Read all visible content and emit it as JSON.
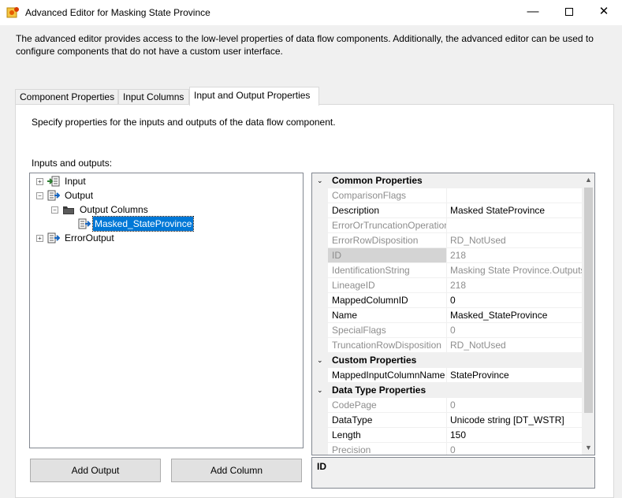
{
  "window": {
    "title": "Advanced Editor for Masking State Province",
    "minimize_glyph": "—",
    "close_glyph": "✕"
  },
  "description": "The advanced editor provides access to the low-level properties of data flow components. Additionally, the advanced editor can be used to configure components that do not have a custom user interface.",
  "tabs": [
    {
      "label": "Component Properties",
      "active": false
    },
    {
      "label": "Input Columns",
      "active": false
    },
    {
      "label": "Input and Output Properties",
      "active": true
    }
  ],
  "panel": {
    "description": "Specify properties for the inputs and outputs of the data flow component.",
    "inputs_outputs_label": "Inputs and outputs:"
  },
  "tree": {
    "nodes": [
      {
        "label": "Input",
        "expander": "+",
        "icon": "input-icon"
      },
      {
        "label": "Output",
        "expander": "−",
        "icon": "output-icon"
      },
      {
        "label": "Output Columns",
        "expander": "−",
        "icon": "folder-icon"
      },
      {
        "label": "Masked_StateProvince",
        "expander": "",
        "icon": "column-icon",
        "selected": true
      },
      {
        "label": "ErrorOutput",
        "expander": "+",
        "icon": "output-icon"
      }
    ]
  },
  "buttons": {
    "add_output": "Add Output",
    "add_column": "Add Column"
  },
  "properties": {
    "categories": [
      {
        "title": "Common Properties",
        "rows": [
          {
            "name": "ComparisonFlags",
            "value": "",
            "readonly": true
          },
          {
            "name": "Description",
            "value": "Masked StateProvince",
            "readonly": false
          },
          {
            "name": "ErrorOrTruncationOperation",
            "value": "",
            "readonly": true
          },
          {
            "name": "ErrorRowDisposition",
            "value": "RD_NotUsed",
            "readonly": true
          },
          {
            "name": "ID",
            "value": "218",
            "readonly": true,
            "selected": true
          },
          {
            "name": "IdentificationString",
            "value": "Masking State Province.Outputs",
            "readonly": true
          },
          {
            "name": "LineageID",
            "value": "218",
            "readonly": true
          },
          {
            "name": "MappedColumnID",
            "value": "0",
            "readonly": false
          },
          {
            "name": "Name",
            "value": "Masked_StateProvince",
            "readonly": false
          },
          {
            "name": "SpecialFlags",
            "value": "0",
            "readonly": true
          },
          {
            "name": "TruncationRowDisposition",
            "value": "RD_NotUsed",
            "readonly": true
          }
        ]
      },
      {
        "title": "Custom Properties",
        "rows": [
          {
            "name": "MappedInputColumnName",
            "value": "StateProvince",
            "readonly": false
          }
        ]
      },
      {
        "title": "Data Type Properties",
        "rows": [
          {
            "name": "CodePage",
            "value": "0",
            "readonly": true
          },
          {
            "name": "DataType",
            "value": "Unicode string [DT_WSTR]",
            "readonly": false
          },
          {
            "name": "Length",
            "value": "150",
            "readonly": false
          },
          {
            "name": "Precision",
            "value": "0",
            "readonly": true
          }
        ]
      }
    ],
    "collapse_glyph": "⌄",
    "description_title": "ID"
  }
}
